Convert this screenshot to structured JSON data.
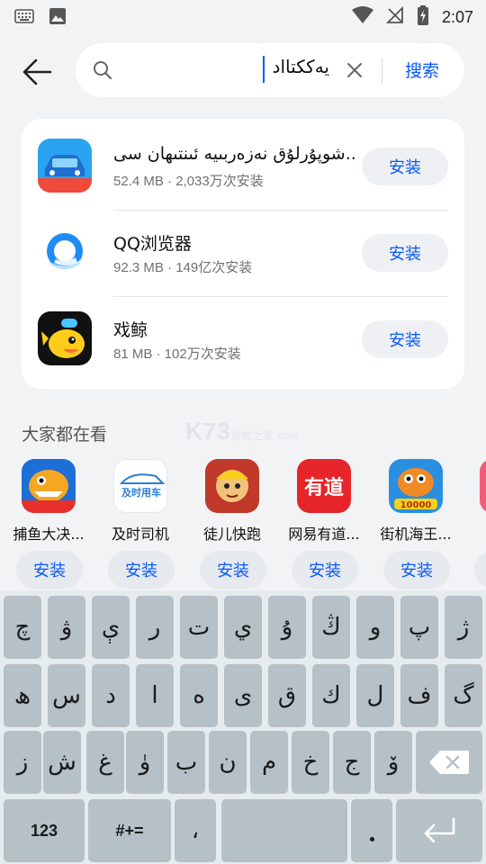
{
  "status_bar": {
    "time": "2:07"
  },
  "search": {
    "query": "يەككتااد",
    "button_label": "搜索"
  },
  "results": [
    {
      "name": "شوپۇرلۇق نەزەربىيە ئىنتىھان سى..",
      "meta": "52.4 MB · 2,033万次安装",
      "install_label": "安装",
      "icon": "car-app-icon"
    },
    {
      "name": "QQ浏览器",
      "meta": "92.3 MB · 149亿次安装",
      "install_label": "安装",
      "icon": "qq-browser-icon"
    },
    {
      "name": "戏鲸",
      "meta": "81 MB · 102万次安装",
      "install_label": "安装",
      "icon": "xijing-whale-icon"
    }
  ],
  "section": {
    "title": "大家都在看",
    "watermark": "K73",
    "watermark_sub": "游戏之家",
    "watermark_domain": ".com"
  },
  "recommended": [
    {
      "name": "捕鱼大决...",
      "install_label": "安装",
      "icon": "fishing-game-icon"
    },
    {
      "name": "及时司机",
      "install_label": "安装",
      "icon": "driver-app-icon",
      "icon_text": "及时用车"
    },
    {
      "name": "徒儿快跑",
      "install_label": "安装",
      "icon": "monkey-king-icon"
    },
    {
      "name": "网易有道...",
      "install_label": "安装",
      "icon": "youdao-icon",
      "icon_text": "有道"
    },
    {
      "name": "街机海王...",
      "install_label": "安装",
      "icon": "arcade-fish-icon",
      "icon_text": "10000"
    },
    {
      "name": "",
      "install_label": "安",
      "icon": "partial-app-icon"
    }
  ],
  "keyboard": {
    "row1": [
      "چ",
      "ۋ",
      "ې",
      "ر",
      "ت",
      "ي",
      "ۇ",
      "ڭ",
      "و",
      "پ",
      "ژ"
    ],
    "row2": [
      "ھ",
      "س",
      "د",
      "ا",
      "ە",
      "ى",
      "ق",
      "ك",
      "ل",
      "ف",
      "گ"
    ],
    "row3": [
      "ز",
      "ش",
      "غ",
      "ۈ",
      "ب",
      "ن",
      "م",
      "خ",
      "ج",
      "ۆ"
    ],
    "row4": {
      "numbers": "123",
      "symbols": "#+=",
      "comma": "،"
    }
  },
  "colors": {
    "accent": "#0a59f7",
    "background": "#f1f3f5",
    "key": "#b5c1c7"
  }
}
